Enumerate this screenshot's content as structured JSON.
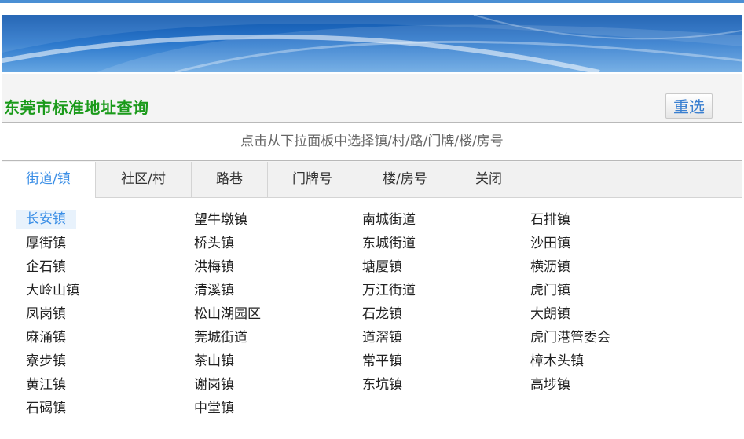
{
  "header": {
    "title": "东莞市标准地址查询",
    "reset_label": "重选"
  },
  "address_display": {
    "placeholder": "点击从下拉面板中选择镇/村/路/门牌/楼/房号"
  },
  "tabs": [
    {
      "label": "街道/镇",
      "active": true
    },
    {
      "label": "社区/村",
      "active": false
    },
    {
      "label": "路巷",
      "active": false
    },
    {
      "label": "门牌号",
      "active": false
    },
    {
      "label": "楼/房号",
      "active": false
    },
    {
      "label": "关闭",
      "active": false
    }
  ],
  "selected_town": "长安镇",
  "towns": [
    "长安镇",
    "厚街镇",
    "企石镇",
    "大岭山镇",
    "凤岗镇",
    "麻涌镇",
    "寮步镇",
    "黄江镇",
    "石碣镇",
    "望牛墩镇",
    "桥头镇",
    "洪梅镇",
    "清溪镇",
    "松山湖园区",
    "莞城街道",
    "茶山镇",
    "谢岗镇",
    "中堂镇",
    "南城街道",
    "东城街道",
    "塘厦镇",
    "万江街道",
    "石龙镇",
    "道滘镇",
    "常平镇",
    "东坑镇",
    "石排镇",
    "沙田镇",
    "横沥镇",
    "虎门镇",
    "大朗镇",
    "虎门港管委会",
    "樟木头镇",
    "高埗镇"
  ],
  "colors": {
    "title": "#1a9a1a",
    "accent": "#3a8ee6",
    "banner": "#2c78cc"
  }
}
